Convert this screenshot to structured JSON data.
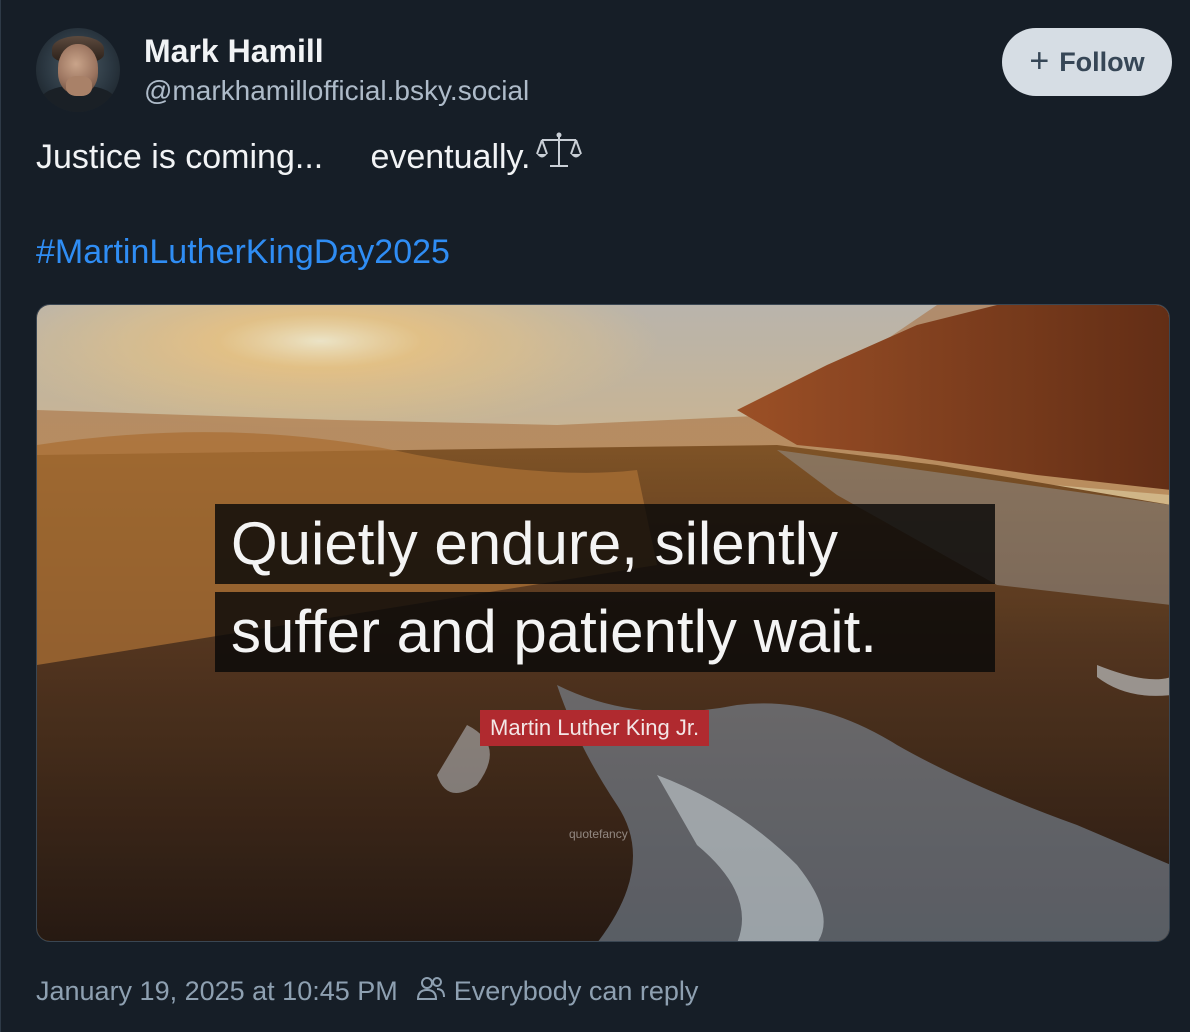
{
  "author": {
    "display_name": "Mark Hamill",
    "handle": "@markhamillofficial.bsky.social"
  },
  "follow_button": {
    "label": "Follow",
    "icon": "plus-icon"
  },
  "post": {
    "text_part1": "Justice is coming...",
    "text_part2": "eventually.",
    "emoji_icon": "balance-scale-icon",
    "hashtag": "#MartinLutherKingDay2025"
  },
  "embed": {
    "quote_line1": "Quietly endure, silently",
    "quote_line2": "suffer and patiently wait.",
    "attribution": "Martin Luther King Jr.",
    "watermark": "quotefancy"
  },
  "footer": {
    "timestamp": "January 19, 2025 at 10:45 PM",
    "reply_setting": "Everybody can reply",
    "reply_icon": "people-icon"
  },
  "colors": {
    "background": "#161e27",
    "accent_link": "#2f8df4",
    "follow_bg": "#d6dde4",
    "attribution_red": "#b02a2f"
  }
}
